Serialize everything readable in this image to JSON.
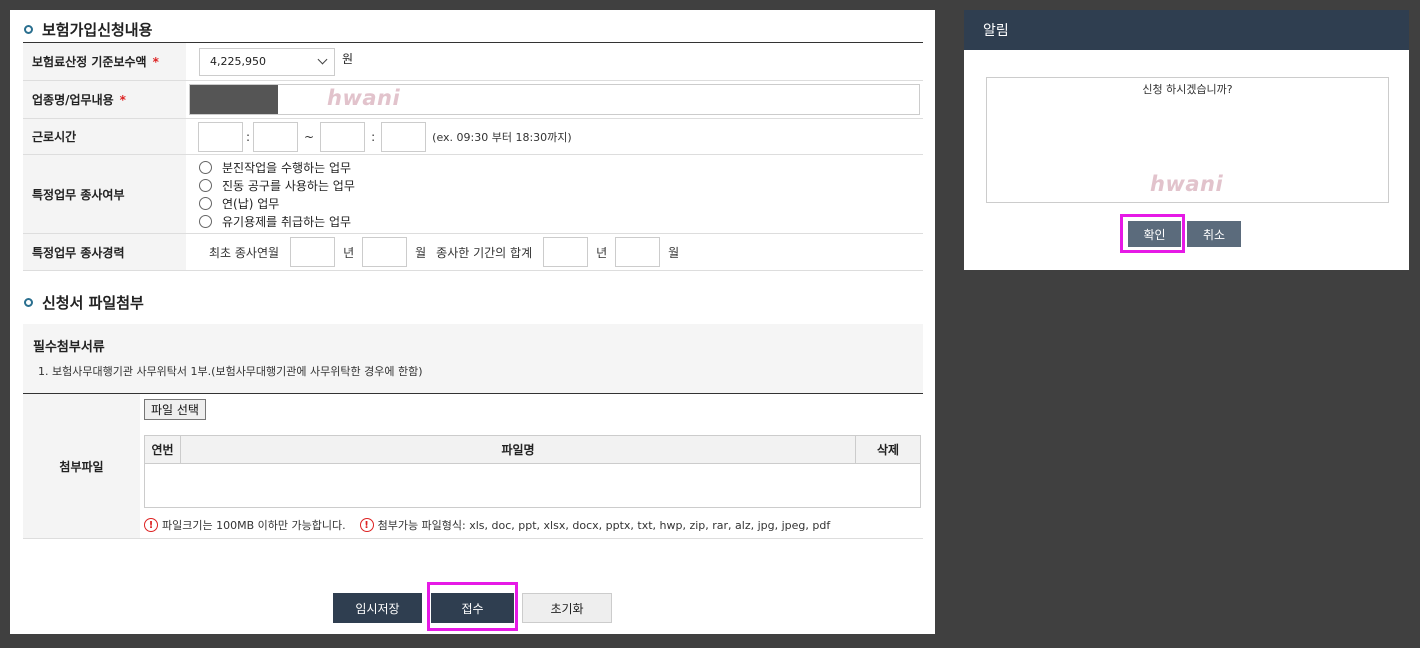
{
  "section1": {
    "title": "보험가입신청내용"
  },
  "form": {
    "wage": {
      "label": "보험료산정 기준보수액",
      "required_mark": "*",
      "value": "4,225,950",
      "unit": "원"
    },
    "business": {
      "label": "업종명/업무내용",
      "required_mark": "*"
    },
    "hours": {
      "label": "근로시간",
      "colon1": ":",
      "tilde": "~",
      "colon2": ":",
      "hint": "(ex. 09:30 부터 18:30까지)"
    },
    "special": {
      "label": "특정업무 종사여부",
      "options": [
        "분진작업을 수행하는 업무",
        "진동 공구를 사용하는 업무",
        "연(납) 업무",
        "유기용제를 취급하는 업무"
      ]
    },
    "career": {
      "label": "특정업무 종사경력",
      "first": "최초 종사연월",
      "year": "년",
      "month": "월",
      "total": "종사한 기간의 합계"
    }
  },
  "watermark": "hwani",
  "section2": {
    "title": "신청서 파일첨부"
  },
  "attach_info": {
    "heading": "필수첨부서류",
    "item": "1. 보험사무대행기관 사무위탁서 1부.(보험사무대행기관에 사무위탁한 경우에 한함)"
  },
  "attach": {
    "label": "첨부파일",
    "file_button": "파일 선택",
    "columns": [
      "연번",
      "파일명",
      "삭제"
    ],
    "notes": [
      "파일크기는 100MB 이하만 가능합니다.",
      "첨부가능 파일형식: xls, doc, ppt, xlsx, docx, pptx, txt, hwp, zip, rar, alz, jpg, jpeg, pdf"
    ],
    "warn_glyph": "!"
  },
  "buttons": {
    "temp_save": "임시저장",
    "submit": "접수",
    "reset": "초기화"
  },
  "dialog": {
    "title": "알림",
    "message": "신청 하시겠습니까?",
    "confirm": "확인",
    "cancel": "취소"
  },
  "colors": {
    "header_navy": "#2f3e50",
    "highlight": "#e619e6",
    "required": "#dd2222"
  }
}
